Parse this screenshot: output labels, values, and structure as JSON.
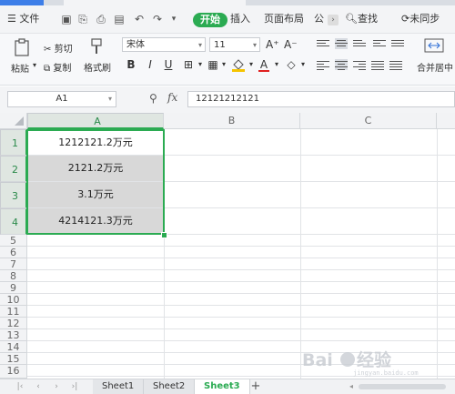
{
  "menubar": {
    "file_label": "文件",
    "start_label": "开始",
    "insert_label": "插入",
    "page_layout_label": "页面布局",
    "formula_label": "公",
    "find_label": "查找",
    "sync_label": "未同步"
  },
  "ribbon": {
    "paste_label": "粘贴",
    "cut_label": "剪切",
    "copy_label": "复制",
    "format_painter_label": "格式刷",
    "font_name": "宋体",
    "font_size": "11",
    "grow_font": "A⁺",
    "shrink_font": "A⁻",
    "bold": "B",
    "italic": "I",
    "underline": "U",
    "font_color_glyph": "A",
    "merge_center_label": "合并居中"
  },
  "formula_bar": {
    "cell_ref": "A1",
    "fx_label": "fx",
    "value": "12121212121"
  },
  "grid": {
    "columns": [
      "A",
      "B",
      "C"
    ],
    "rows": [
      "1",
      "2",
      "3",
      "4",
      "5",
      "6",
      "7",
      "8",
      "9",
      "10",
      "11",
      "12",
      "13",
      "14",
      "15",
      "16"
    ],
    "cells": [
      "1212121.2万元",
      "2121.2万元",
      "3.1万元",
      "4214121.3万元"
    ]
  },
  "sheets": {
    "tab1": "Sheet1",
    "tab2": "Sheet2",
    "tab3": "Sheet3",
    "active": "Sheet3"
  },
  "colors": {
    "accent": "#2bab52",
    "selected_fill": "#d8d8d8",
    "brand_blue": "#3d7ee8"
  }
}
